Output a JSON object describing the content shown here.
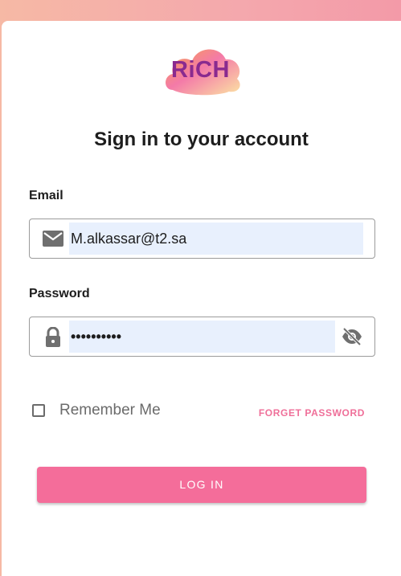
{
  "brand": {
    "logo_text": "RiCH",
    "accent_color": "#f46d9a"
  },
  "title": "Sign in to your account",
  "email": {
    "label": "Email",
    "value": "M.alkassar@t2.sa",
    "icon": "email-icon"
  },
  "password": {
    "label": "Password",
    "value": "••••••••••",
    "icon": "lock-icon",
    "toggle_icon": "eye-off-icon"
  },
  "remember": {
    "label": "Remember Me",
    "checked": false
  },
  "forget_label": "FORGET PASSWORD",
  "login_label": "LOG IN"
}
